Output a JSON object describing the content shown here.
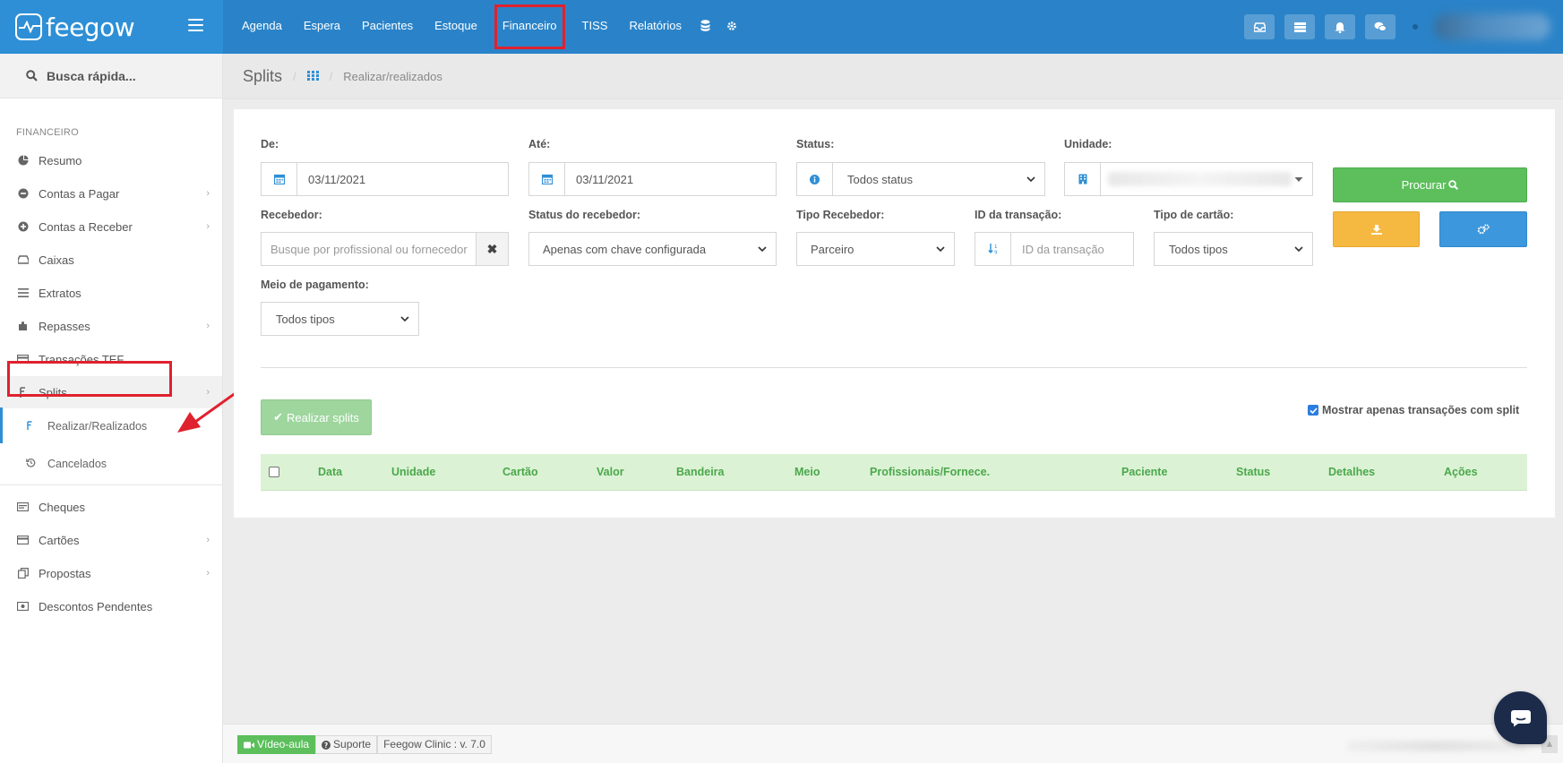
{
  "app": {
    "logo_text": "feegow"
  },
  "topnav": {
    "items": [
      "Agenda",
      "Espera",
      "Pacientes",
      "Estoque",
      "Financeiro",
      "TISS",
      "Relatórios"
    ],
    "active": "Financeiro",
    "icon_items": [
      "database-icon",
      "gear-icon"
    ]
  },
  "topright": {
    "buttons": [
      "inbox-icon",
      "list-icon",
      "bell-icon",
      "chat-icon"
    ]
  },
  "sidebar": {
    "search_label": "Busca rápida...",
    "section_label": "FINANCEIRO",
    "items": [
      {
        "label": "Resumo",
        "icon": "pie-chart-icon",
        "has_children": false
      },
      {
        "label": "Contas a Pagar",
        "icon": "minus-circle-icon",
        "has_children": true
      },
      {
        "label": "Contas a Receber",
        "icon": "plus-circle-icon",
        "has_children": true
      },
      {
        "label": "Caixas",
        "icon": "inbox-icon",
        "has_children": false
      },
      {
        "label": "Extratos",
        "icon": "list-icon",
        "has_children": false
      },
      {
        "label": "Repasses",
        "icon": "puzzle-icon",
        "has_children": true
      },
      {
        "label": "Transações TEF",
        "icon": "credit-card-icon",
        "has_children": false
      },
      {
        "label": "Splits",
        "icon": "split-icon",
        "has_children": true
      },
      {
        "label": "Cheques",
        "icon": "check-book-icon",
        "has_children": false
      },
      {
        "label": "Cartões",
        "icon": "credit-card-icon",
        "has_children": true
      },
      {
        "label": "Propostas",
        "icon": "copy-icon",
        "has_children": true
      },
      {
        "label": "Descontos Pendentes",
        "icon": "money-icon",
        "has_children": false
      }
    ],
    "splits_children": [
      {
        "label": "Realizar/Realizados",
        "icon": "split-icon",
        "active": true
      },
      {
        "label": "Cancelados",
        "icon": "history-icon",
        "active": false
      }
    ]
  },
  "breadcrumb": {
    "title": "Splits",
    "home_icon": "grid-icon",
    "current": "Realizar/realizados"
  },
  "filters": {
    "de": {
      "label": "De:",
      "value": "03/11/2021",
      "icon": "calendar-icon"
    },
    "ate": {
      "label": "Até:",
      "value": "03/11/2021",
      "icon": "calendar-icon"
    },
    "status": {
      "label": "Status:",
      "value": "Todos status",
      "icon": "info-icon"
    },
    "unidade": {
      "label": "Unidade:",
      "value": "",
      "icon": "building-icon"
    },
    "recebedor": {
      "label": "Recebedor:",
      "placeholder": "Busque por profissional ou fornecedor"
    },
    "status_recebedor": {
      "label": "Status do recebedor:",
      "value": "Apenas com chave configurada"
    },
    "tipo_recebedor": {
      "label": "Tipo Recebedor:",
      "value": "Parceiro"
    },
    "id_transacao": {
      "label": "ID da transação:",
      "placeholder": "ID da transação",
      "icon": "sort-numeric-icon"
    },
    "tipo_cartao": {
      "label": "Tipo de cartão:",
      "value": "Todos tipos"
    },
    "meio_pagamento": {
      "label": "Meio de pagamento:",
      "value": "Todos tipos"
    }
  },
  "actions": {
    "procurar": "Procurar",
    "download_icon": "download-icon",
    "config_icon": "cogs-icon",
    "realizar": "Realizar splits",
    "only_split_label": "Mostrar apenas transações com split",
    "only_split_checked": true
  },
  "table": {
    "columns": [
      "Data",
      "Unidade",
      "Cartão",
      "Valor",
      "Bandeira",
      "Meio",
      "Profissionais/Fornece.",
      "Paciente",
      "Status",
      "Detalhes",
      "Ações"
    ],
    "rows": []
  },
  "footer": {
    "video": "Vídeo-aula",
    "support": "Suporte",
    "version": "Feegow Clinic : v. 7.0"
  },
  "colors": {
    "brand": "#2e8fd6",
    "topbar": "#2a83c8",
    "success": "#5cbf5c",
    "warning": "#f5b840",
    "info": "#3d97dc",
    "highlight": "#e0212e"
  }
}
